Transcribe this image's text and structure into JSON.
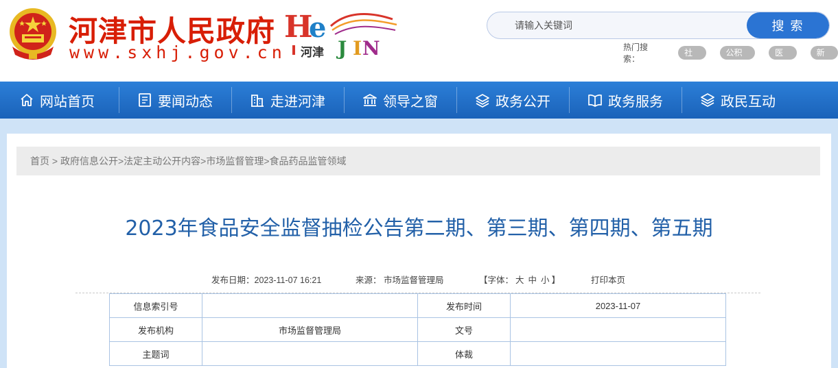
{
  "header": {
    "site_name": "河津市人民政府",
    "site_url": "www.sxhj.gov.cn",
    "logo_text": "河津",
    "search": {
      "placeholder": "请输入关键词",
      "button_label": "搜 索"
    },
    "hot_search": {
      "label": "热门搜索：",
      "tags": [
        "社保",
        "公积金",
        "医疗",
        "新闻"
      ]
    }
  },
  "nav": {
    "items": [
      {
        "label": "网站首页",
        "icon": "home-icon"
      },
      {
        "label": "要闻动态",
        "icon": "news-icon"
      },
      {
        "label": "走进河津",
        "icon": "building-icon"
      },
      {
        "label": "领导之窗",
        "icon": "government-hall-icon"
      },
      {
        "label": "政务公开",
        "icon": "layers-icon"
      },
      {
        "label": "政务服务",
        "icon": "book-icon"
      },
      {
        "label": "政民互动",
        "icon": "stack-icon"
      }
    ]
  },
  "breadcrumb": {
    "items": [
      "首页",
      " > ",
      "政府信息公开",
      ">",
      "法定主动公开内容",
      ">",
      "市场监督管理",
      ">",
      "食品药品监管领域"
    ]
  },
  "article": {
    "title": "2023年食品安全监督抽检公告第二期、第三期、第四期、第五期",
    "meta": {
      "date_label": "发布日期：",
      "date_value": "2023-11-07 16:21",
      "source_label": "来源：",
      "source_value": "市场监督管理局",
      "font_label_open": "【字体：",
      "font_large": "大",
      "font_medium": "中",
      "font_small": "小",
      "font_label_close": "】",
      "print_label": "打印本页"
    },
    "info_table": [
      [
        "信息索引号",
        "",
        "发布时间",
        "2023-11-07"
      ],
      [
        "发布机构",
        "市场监督管理局",
        "文号",
        ""
      ],
      [
        "主题词",
        "",
        "体裁",
        ""
      ]
    ]
  },
  "colors": {
    "brand_red": "#d81e06",
    "nav_blue": "#1f6cc5",
    "title_blue": "#2260a8",
    "page_bg": "#cfe3f7"
  }
}
